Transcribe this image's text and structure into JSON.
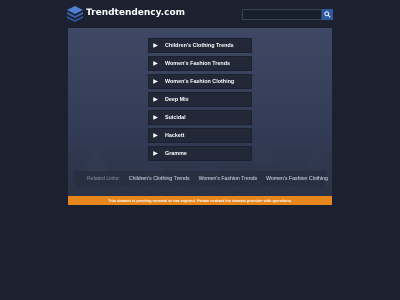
{
  "header": {
    "site_title": "Trendtendency.com",
    "logo_icon": "stacked-layers-icon",
    "search_placeholder": "",
    "search_icon": "search-icon"
  },
  "menu": {
    "items": [
      {
        "label": "Children's Clothing Trends"
      },
      {
        "label": "Women's Fashion Trends"
      },
      {
        "label": "Women's Fashion Clothing"
      },
      {
        "label": "Deep Mix"
      },
      {
        "label": "Suicidal"
      },
      {
        "label": "Hackett"
      },
      {
        "label": "Gramme"
      }
    ]
  },
  "related": {
    "label": "Related Links:",
    "links": [
      "Children's Clothing Trends",
      "Women's Fashion Trends",
      "Women's Fashion Clothing"
    ]
  },
  "notice": {
    "text": "This domain is pending renewal or has expired. Please contact the domain provider with questions."
  },
  "colors": {
    "background": "#1c2130",
    "panel": "#3e4864",
    "menu_item": "#222838",
    "notice": "#e6861d",
    "search_button": "#2f5aa3"
  }
}
